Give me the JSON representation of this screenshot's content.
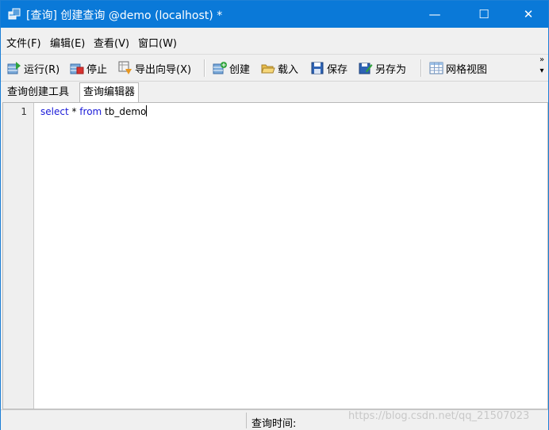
{
  "window": {
    "title": "[查询] 创建查询 @demo (localhost) *",
    "minimize_glyph": "—",
    "maximize_glyph": "☐",
    "close_glyph": "✕"
  },
  "menu": {
    "items": [
      "文件(F)",
      "编辑(E)",
      "查看(V)",
      "窗口(W)"
    ]
  },
  "toolbar": {
    "run": "运行(R)",
    "stop": "停止",
    "export_wizard": "导出向导(X)",
    "create": "创建",
    "load": "载入",
    "save": "保存",
    "save_as": "另存为",
    "grid_view": "网格视图",
    "overflow_glyph": "»",
    "overflow_arrow": "▾"
  },
  "tabs": [
    "查询创建工具",
    "查询编辑器"
  ],
  "active_tab": "查询编辑器",
  "editor": {
    "line_numbers": [
      "1"
    ],
    "code_tokens": [
      "select",
      " * ",
      "from",
      " tb_demo"
    ]
  },
  "status": {
    "query_time_label": "查询时间:",
    "watermark": "https://blog.csdn.net/qq_21507023"
  },
  "colors": {
    "titlebar": "#0a79d8",
    "keyword": "#1a1ad8"
  }
}
